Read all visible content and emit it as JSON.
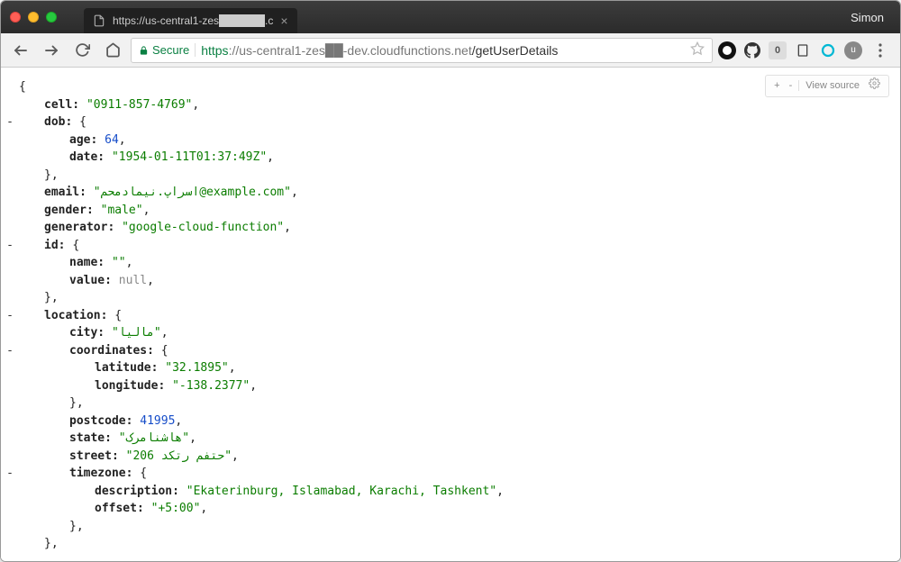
{
  "window": {
    "tab_title": "https://us-central1-zes██████.c",
    "user_name": "Simon"
  },
  "urlbar": {
    "secure_label": "Secure",
    "scheme": "https",
    "host": "://us-central1-zes██-dev.cloudfunctions.net",
    "path": "/getUserDetails"
  },
  "jsonview": {
    "plus": "+",
    "minus": "-",
    "view_source": "View source"
  },
  "json": {
    "open": "{",
    "cell_key": "cell:",
    "cell_val": "\"0911-857-4769\"",
    "dob_key": "dob:",
    "dob_open": "{",
    "dob_age_key": "age:",
    "dob_age_val": "64",
    "dob_date_key": "date:",
    "dob_date_val": "\"1954-01-11T01:37:49Z\"",
    "dob_close": "},",
    "email_key": "email:",
    "email_val": "\"محمدامین.پارسا@example.com\"",
    "gender_key": "gender:",
    "gender_val": "\"male\"",
    "generator_key": "generator:",
    "generator_val": "\"google-cloud-function\"",
    "id_key": "id:",
    "id_open": "{",
    "id_name_key": "name:",
    "id_name_val": "\"\"",
    "id_value_key": "value:",
    "id_value_val": "null",
    "id_close": "},",
    "location_key": "location:",
    "location_open": "{",
    "loc_city_key": "city:",
    "loc_city_val": "\"ایلام\"",
    "loc_coord_key": "coordinates:",
    "loc_coord_open": "{",
    "loc_lat_key": "latitude:",
    "loc_lat_val": "\"32.1895\"",
    "loc_lon_key": "longitude:",
    "loc_lon_val": "\"-138.2377\"",
    "loc_coord_close": "},",
    "loc_post_key": "postcode:",
    "loc_post_val": "41995",
    "loc_state_key": "state:",
    "loc_state_val": "\"کرمانشاه\"",
    "loc_street_key": "street:",
    "loc_street_val": "\"206 دکتر مفتح\"",
    "loc_tz_key": "timezone:",
    "loc_tz_open": "{",
    "loc_tz_desc_key": "description:",
    "loc_tz_desc_val": "\"Ekaterinburg, Islamabad, Karachi, Tashkent\"",
    "loc_tz_off_key": "offset:",
    "loc_tz_off_val": "\"+5:00\"",
    "loc_tz_close": "},",
    "loc_close": "},",
    "comma": ",",
    "collapse": "-"
  }
}
